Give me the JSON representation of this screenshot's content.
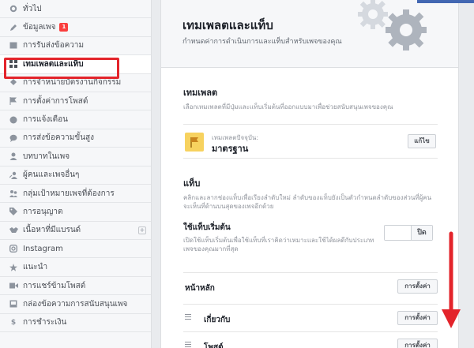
{
  "sidebar": {
    "items": [
      {
        "label": "ทั่วไป",
        "icon": "gear-icon"
      },
      {
        "label": "ข้อมูลเพจ",
        "icon": "pencil-icon",
        "badge": "1"
      },
      {
        "label": "การรับส่งข้อความ",
        "icon": "message-icon"
      },
      {
        "label": "เทมเพลตและแท็บ",
        "icon": "grid-icon"
      },
      {
        "label": "การจำหน่ายบัตรงานกิจกรรม",
        "icon": "ticket-icon"
      },
      {
        "label": "การตั้งค่าการโพสต์",
        "icon": "flag-icon"
      },
      {
        "label": "การแจ้งเตือน",
        "icon": "globe-icon"
      },
      {
        "label": "การส่งข้อความขั้นสูง",
        "icon": "chat-icon"
      },
      {
        "label": "บทบาทในเพจ",
        "icon": "person-icon"
      },
      {
        "label": "ผู้คนและเพจอื่นๆ",
        "icon": "people-icon"
      },
      {
        "label": "กลุ่มเป้าหมายเพจที่ต้องการ",
        "icon": "audience-icon"
      },
      {
        "label": "การอนุญาต",
        "icon": "tag-icon"
      },
      {
        "label": "เนื้อหาที่มีแบรนด์",
        "icon": "handshake-icon"
      },
      {
        "label": "Instagram",
        "icon": "instagram-icon"
      },
      {
        "label": "แนะนำ",
        "icon": "star-icon"
      },
      {
        "label": "การแชร์ข้ามโพสต์",
        "icon": "video-icon"
      },
      {
        "label": "กล่องข้อความการสนับสนุนเพจ",
        "icon": "inbox-icon"
      },
      {
        "label": "การชำระเงิน",
        "icon": "dollar-icon"
      }
    ]
  },
  "header": {
    "title": "เทมเพลตและแท็บ",
    "subtitle": "กำหนดค่าการดำเนินการและแท็บสำหรับเพจของคุณ"
  },
  "template": {
    "title": "เทมเพลต",
    "description": "เลือกเทมเพลตที่มีปุ่มและแท็บเริ่มต้นที่ออกแบบมาเพื่อช่วยสนับสนุนเพจของคุณ",
    "current_label": "เทมเพลตปัจจุบัน:",
    "current_value": "มาตรฐาน",
    "edit_label": "แก้ไข"
  },
  "tabs": {
    "title": "แท็บ",
    "description": "คลิกและลากช่องแท็บเพื่อเรียงลำดับใหม่ ลำดับของแท็บยังเป็นตัวกำหนดลำดับของส่วนที่ผู้คนจะเห็นที่ด้านบนสุดของเพจอีกด้วย",
    "default_tabs_title": "ใช้แท็บเริ่มต้น",
    "default_tabs_desc": "เปิดใช้แท็บเริ่มต้นเพื่อใช้แท็บที่เราคิดว่าเหมาะและใช้ได้ผลดีกับประเภทเพจของคุณมากที่สุด",
    "toggle_off_label": "ปิด",
    "settings_label": "การตั้งค่า",
    "list": [
      {
        "label": "หน้าหลัก"
      },
      {
        "label": "เกี่ยวกับ"
      },
      {
        "label": "โพสต์"
      }
    ]
  },
  "colors": {
    "highlight": "#e3242b",
    "flag": "#f7d25f",
    "badge": "#fa3e3e"
  }
}
